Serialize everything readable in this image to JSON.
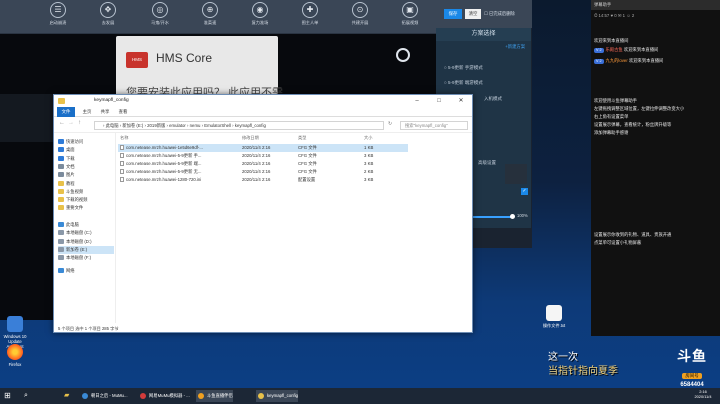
{
  "toolbar": {
    "items": [
      "启动崩溃",
      "去发展",
      "马鬼/开水",
      "准菜速",
      "复力准场",
      "图主人单",
      "共建开展",
      "拓展视频"
    ],
    "save_label": "保存",
    "clear_label": "清空",
    "delete_label": "已完成后删除"
  },
  "dialog": {
    "logo": "HMS",
    "title": "HMS Core",
    "question": "您要安装此应用吗？ 此应用不需"
  },
  "plan": {
    "header": "方案选择",
    "new_plan": "+新建方案",
    "items": [
      "5-9更新 手游模式",
      "5-9更新 端游模式",
      "入机模式",
      "高级设置"
    ],
    "slider_value": "100%"
  },
  "explorer": {
    "title": "keymapfl_config",
    "tabs": [
      "文件",
      "主页",
      "共享",
      "查看"
    ],
    "path": "› 此电脑 › 新加卷 (E:) › 2019新版 › emulator › nemu › EmulatorShell › keymapfl_config",
    "search_placeholder": "搜索\"keymapfl_config\"",
    "nav": [
      {
        "label": "快速访问",
        "color": "#2e7bd8"
      },
      {
        "label": "桌面",
        "color": "#2e7bd8"
      },
      {
        "label": "下载",
        "color": "#2e7bd8"
      },
      {
        "label": "文档",
        "color": "#7b8b9c"
      },
      {
        "label": "图片",
        "color": "#7b8b9c"
      },
      {
        "label": "教程",
        "color": "#e8c14a"
      },
      {
        "label": "斗鱼视频",
        "color": "#e8c14a"
      },
      {
        "label": "下载的视频",
        "color": "#e8c14a"
      },
      {
        "label": "重要文件",
        "color": "#e8c14a"
      },
      {
        "label": "此电脑",
        "color": "#3a8ad6"
      },
      {
        "label": "本地磁盘 (C:)",
        "color": "#8a98a8"
      },
      {
        "label": "本地磁盘 (D:)",
        "color": "#8a98a8"
      },
      {
        "label": "新加卷 (E:)",
        "color": "#8a98a8"
      },
      {
        "label": "本地磁盘 (F:)",
        "color": "#8a98a8"
      },
      {
        "label": "网络",
        "color": "#3a8ad6"
      }
    ],
    "columns": [
      "名称",
      "修改日期",
      "类型",
      "大小"
    ],
    "files": [
      {
        "name": "com.netease.mrzh.huawei-1e5d6e9df-...",
        "date": "2020/11/4 2:16",
        "type": "CFG 文件",
        "size": "1 KB"
      },
      {
        "name": "com.netease.mrzh.huawei-5-9更新 手...",
        "date": "2020/11/4 2:16",
        "type": "CFG 文件",
        "size": "3 KB"
      },
      {
        "name": "com.netease.mrzh.huawei-5-9更新 端...",
        "date": "2020/11/4 2:16",
        "type": "CFG 文件",
        "size": "3 KB"
      },
      {
        "name": "com.netease.mrzh.huawei-5-9更新 无...",
        "date": "2020/11/4 2:16",
        "type": "CFG 文件",
        "size": "2 KB"
      },
      {
        "name": "com.netease.mrzh.huawei-1280-720.ini",
        "date": "2020/11/4 2:16",
        "type": "配置设置",
        "size": "3 KB"
      }
    ],
    "status": "5 个项目    选中 1 个项目  285 字节"
  },
  "chat": {
    "header": "弹幕助手",
    "stats": [
      "14:57",
      "0",
      "1",
      "2"
    ],
    "welcome": "欢迎来到本直播间",
    "msgs": [
      {
        "tag": "V 2",
        "name": "乐殿古鱼",
        "text": " 欢迎来到本直播间",
        "c": "#d23b3b"
      },
      {
        "tag": "V 2",
        "name": "九九的lover",
        "text": " 欢迎来到本直播间",
        "c": "#e07a22"
      }
    ],
    "tip1": [
      "欢迎使用斗鱼弹幕助手",
      "左键拖拽调整区域位置，左键拉伸调整改变大小",
      "右上角有设置菜单",
      "设置展示弹幕，查看统计，粉丝牌升级等",
      "添加弹幕助手感谢"
    ],
    "tip2": [
      "设置展示你收到的礼物、道具、贵族开通",
      "点菜单可设置小礼物屏蔽"
    ]
  },
  "desktop": {
    "icons": [
      "Windows 10 Update Assistant",
      "Firefox",
      "操作文件.txt"
    ]
  },
  "game": {
    "line1": "这一次",
    "line2": "当指针指向夏季"
  },
  "douyu": {
    "logo": "斗鱼",
    "room_label": "房间号",
    "room": "6584404"
  },
  "taskbar": {
    "items": [
      "朝日之后 - MuMu...",
      "网易MuMu模拟器 - ...",
      "斗鱼直播伴侣",
      "keymapfl_config"
    ],
    "time": "2:16",
    "date": "2020/11/4"
  }
}
